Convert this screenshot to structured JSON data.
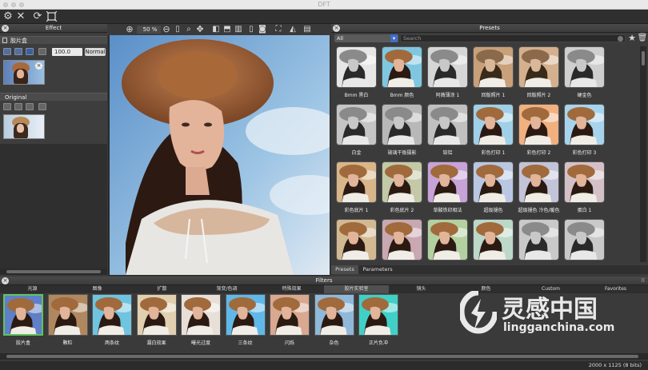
{
  "window": {
    "title": "DFT"
  },
  "toolbar": {
    "icons": [
      "gear-icon",
      "close-icon",
      "refresh-icon",
      "fit-icon"
    ]
  },
  "effect_panel": {
    "title": "Effect",
    "layer_name": "胶片盒",
    "opacity_value": "100.0",
    "blend_mode": "Normal",
    "original_label": "Original"
  },
  "viewer": {
    "zoom": "50 %"
  },
  "presets_panel": {
    "title": "Presets",
    "filter_select": "All",
    "search_placeholder": "Search",
    "tabs": [
      "Presets",
      "Parameters"
    ],
    "rows": [
      [
        {
          "label": "Bmm 黑白",
          "tint": "#e6e6e6",
          "tone": "bw"
        },
        {
          "label": "Bmm 颜色",
          "tint": "#7fc7e0",
          "tone": "color"
        },
        {
          "label": "阿薇薄涂 1",
          "tint": "#d6d6d6",
          "tone": "bw"
        },
        {
          "label": "回版照片 1",
          "tint": "#c8a07a",
          "tone": "sepia"
        },
        {
          "label": "回版照片 2",
          "tint": "#d4b08e",
          "tone": "sepia"
        },
        {
          "label": "硬金色",
          "tint": "#cfcfcf",
          "tone": "bw"
        }
      ],
      [
        {
          "label": "白金",
          "tint": "#c5c5c5",
          "tone": "bw"
        },
        {
          "label": "玻璃干板摄影",
          "tint": "#b8b8b8",
          "tone": "bw"
        },
        {
          "label": "铂铝",
          "tint": "#c0c0c0",
          "tone": "bw"
        },
        {
          "label": "彩色打印 1",
          "tint": "#9fd0e8",
          "tone": "color"
        },
        {
          "label": "彩色打印 2",
          "tint": "#f0b080",
          "tone": "warm"
        },
        {
          "label": "彩色打印 3",
          "tint": "#a7d4ec",
          "tone": "color"
        }
      ],
      [
        {
          "label": "彩色底片 1",
          "tint": "#d9b58a",
          "tone": "warm"
        },
        {
          "label": "彩色底片 2",
          "tint": "#c3c9a6",
          "tone": "warm"
        },
        {
          "label": "草酸铁印相法",
          "tint": "#c7a3d8",
          "tone": "purple"
        },
        {
          "label": "超级褪色",
          "tint": "#b9c7e3",
          "tone": "color"
        },
        {
          "label": "超级褪色 冷色/暖色",
          "tint": "#c4c4d8",
          "tone": "color"
        },
        {
          "label": "蛋白 1",
          "tint": "#d4c1c8",
          "tone": "warm"
        }
      ],
      [
        {
          "label": "",
          "tint": "#d2b992",
          "tone": "warm"
        },
        {
          "label": "",
          "tint": "#c9a8b2",
          "tone": "warm"
        },
        {
          "label": "",
          "tint": "#b3d1a0",
          "tone": "color"
        },
        {
          "label": "",
          "tint": "#bcd8c8",
          "tone": "color"
        },
        {
          "label": "",
          "tint": "#c9c9c9",
          "tone": "bw"
        },
        {
          "label": "",
          "tint": "#c9c9c9",
          "tone": "bw"
        }
      ]
    ]
  },
  "filters_panel": {
    "title": "Filters",
    "categories": [
      "光源",
      "图像",
      "扩散",
      "渐变/色调",
      "特殊效果",
      "胶片实验室",
      "镜头",
      "颜色",
      "Custom",
      "Favorites"
    ],
    "active_category": "胶片实验室",
    "items": [
      {
        "label": "胶片盒",
        "tint": "#5f7fc8",
        "tone": "color"
      },
      {
        "label": "颗粒",
        "tint": "#b08860",
        "tone": "warm"
      },
      {
        "label": "两条纹",
        "tint": "#6fc4e0",
        "tone": "color"
      },
      {
        "label": "漏白效果",
        "tint": "#e0d0b0",
        "tone": "warm"
      },
      {
        "label": "曝光过度",
        "tint": "#e8e0d8",
        "tone": "warm"
      },
      {
        "label": "三条纹",
        "tint": "#60b8e8",
        "tone": "color"
      },
      {
        "label": "闪烁",
        "tint": "#d8a890",
        "tone": "warm"
      },
      {
        "label": "杂色",
        "tint": "#90b8d8",
        "tone": "color"
      },
      {
        "label": "正片负冲",
        "tint": "#40d0c8",
        "tone": "color"
      }
    ]
  },
  "status": {
    "resolution": "2000 x 1125 (8 bits)"
  },
  "watermark": {
    "cn": "灵感中国",
    "url": "lingganchina.com"
  }
}
